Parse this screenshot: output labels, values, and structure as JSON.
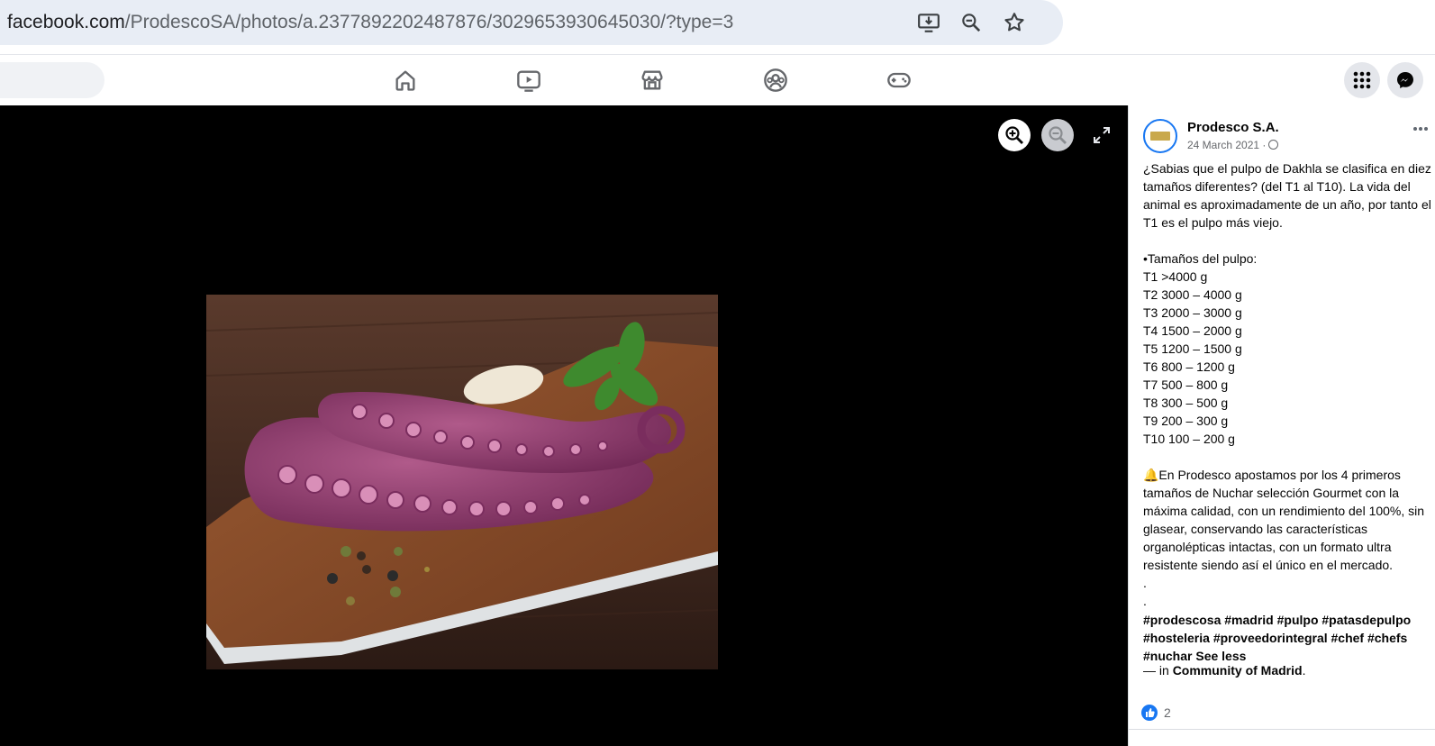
{
  "browser": {
    "url_host": "facebook.com",
    "url_path": "/ProdescoSA/photos/a.2377892202487876/3029653930645030/?type=3",
    "icons": [
      "install-app-icon",
      "zoom-icon",
      "bookmark-star-icon"
    ]
  },
  "nav": {
    "icons": [
      "home-icon",
      "video-icon",
      "marketplace-icon",
      "groups-icon",
      "gaming-icon"
    ],
    "right_icons": [
      "menu-grid-icon",
      "messenger-icon"
    ]
  },
  "viewer": {
    "controls": [
      "zoom-in-icon",
      "zoom-out-icon",
      "fullscreen-icon"
    ],
    "photo_subject": "octopus-tentacles-on-cutting-board"
  },
  "post": {
    "author": "Prodesco S.A.",
    "date": "24 March 2021 ·",
    "text": "¿Sabias que el pulpo de Dakhla se clasifica en diez tamaños diferentes? (del T1 al T10). La vida del animal es aproximadamente de un año, por tanto el T1 es el pulpo más viejo.\n\n•Tamaños del pulpo:\nT1 >4000 g\nT2 3000 – 4000 g\nT3 2000 – 3000 g\nT4 1500 – 2000 g\nT5 1200 – 1500 g\nT6 800 – 1200 g\nT7 500 – 800 g\nT8 300 – 500 g\nT9 200 – 300 g\nT10 100 – 200 g\n\n🔔En Prodesco apostamos por los 4 primeros tamaños de Nuchar selección Gourmet con la máxima calidad, con un rendimiento del 100%, sin glasear, conservando las características organolépticas intactas, con un formato ultra resistente siendo así el único en el mercado.\n.\n.",
    "hashtags": "#prodescosa #madrid #pulpo #patasdepulpo #hosteleria #proveedorintegral #chef #chefs #nuchar",
    "see_less": "See less",
    "location_prefix": "— in ",
    "location": "Community of Madrid",
    "location_suffix": ".",
    "like_count": "2"
  },
  "colors": {
    "accent": "#1877f2",
    "viewer_bg": "#000000",
    "addr_bg": "#e8edf5"
  }
}
